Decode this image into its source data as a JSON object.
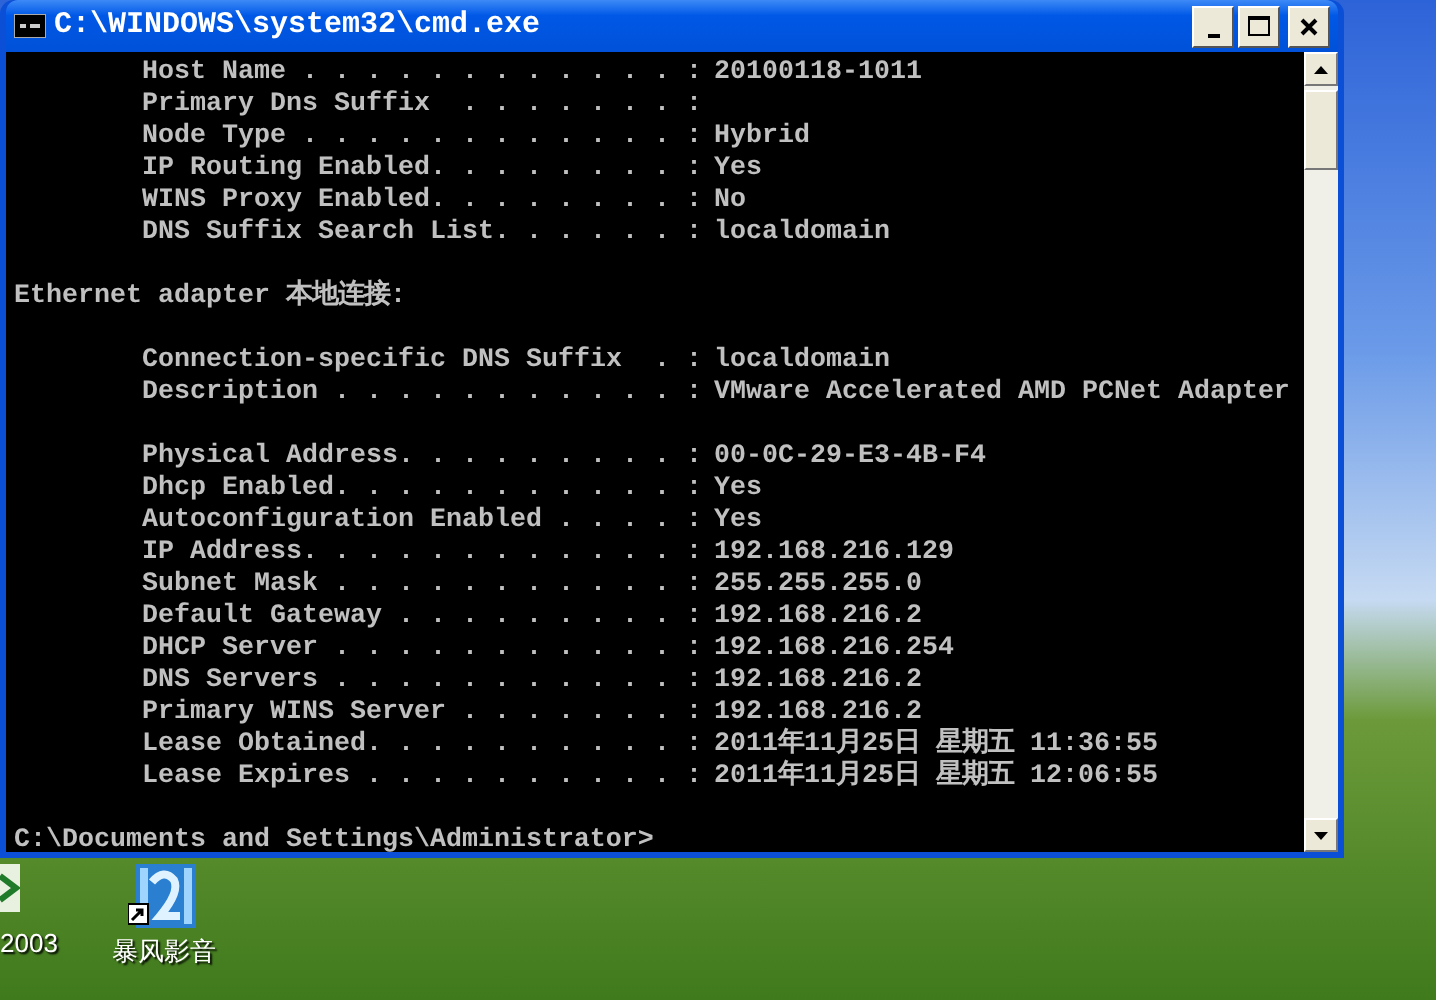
{
  "window": {
    "title": "C:\\WINDOWS\\system32\\cmd.exe"
  },
  "console_lines": [
    {
      "kind": "entry",
      "label": "Host Name . . . . . . . . . . . . :",
      "value": "20100118-1011"
    },
    {
      "kind": "entry",
      "label": "Primary Dns Suffix  . . . . . . . :"
    },
    {
      "kind": "entry",
      "label": "Node Type . . . . . . . . . . . . :",
      "value": "Hybrid"
    },
    {
      "kind": "entry",
      "label": "IP Routing Enabled. . . . . . . . :",
      "value": "Yes"
    },
    {
      "kind": "entry",
      "label": "WINS Proxy Enabled. . . . . . . . :",
      "value": "No"
    },
    {
      "kind": "entry",
      "label": "DNS Suffix Search List. . . . . . :",
      "value": "localdomain"
    },
    {
      "kind": "blank"
    },
    {
      "kind": "heading",
      "text": "Ethernet adapter 本地连接:"
    },
    {
      "kind": "blank"
    },
    {
      "kind": "entry",
      "label": "Connection-specific DNS Suffix  . :",
      "value": "localdomain"
    },
    {
      "kind": "entry",
      "label": "Description . . . . . . . . . . . :",
      "value": "VMware Accelerated AMD PCNet Adapter"
    },
    {
      "kind": "blank"
    },
    {
      "kind": "entry",
      "label": "Physical Address. . . . . . . . . :",
      "value": "00-0C-29-E3-4B-F4"
    },
    {
      "kind": "entry",
      "label": "Dhcp Enabled. . . . . . . . . . . :",
      "value": "Yes"
    },
    {
      "kind": "entry",
      "label": "Autoconfiguration Enabled . . . . :",
      "value": "Yes"
    },
    {
      "kind": "entry",
      "label": "IP Address. . . . . . . . . . . . :",
      "value": "192.168.216.129"
    },
    {
      "kind": "entry",
      "label": "Subnet Mask . . . . . . . . . . . :",
      "value": "255.255.255.0"
    },
    {
      "kind": "entry",
      "label": "Default Gateway . . . . . . . . . :",
      "value": "192.168.216.2"
    },
    {
      "kind": "entry",
      "label": "DHCP Server . . . . . . . . . . . :",
      "value": "192.168.216.254"
    },
    {
      "kind": "entry",
      "label": "DNS Servers . . . . . . . . . . . :",
      "value": "192.168.216.2"
    },
    {
      "kind": "entry",
      "label": "Primary WINS Server . . . . . . . :",
      "value": "192.168.216.2"
    },
    {
      "kind": "entry",
      "label": "Lease Obtained. . . . . . . . . . :",
      "value": "2011年11月25日 星期五 11:36:55"
    },
    {
      "kind": "entry",
      "label": "Lease Expires . . . . . . . . . . :",
      "value": "2011年11月25日 星期五 12:06:55"
    },
    {
      "kind": "blank"
    },
    {
      "kind": "prompt",
      "text": "C:\\Documents and Settings\\Administrator>"
    }
  ],
  "desktop_icons": [
    {
      "kind": "spreadsheet",
      "label": "2003"
    },
    {
      "kind": "film",
      "label": "暴风影音"
    }
  ]
}
